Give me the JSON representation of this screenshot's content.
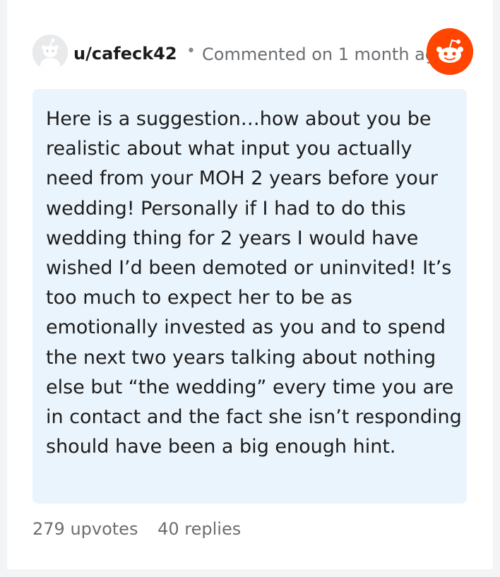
{
  "comment": {
    "username": "u/cafeck42",
    "separator": "•",
    "meta": "Commented on 1 month ago",
    "body": "Here is a suggestion…how about you be realistic about what input you actually need from your MOH 2 years before your wedding! Personally if I had to do this wedding thing for 2 years I would have wished I’d been demoted or uninvited! It’s too much to expect her to be as emotionally invested as you and to spend the next two years talking about nothing else but “the wedding” every time you are in contact and the fact she isn’t responding should have been a big enough hint.",
    "upvotes": "279 upvotes",
    "replies": "40 replies"
  },
  "icons": {
    "avatar": "default-user-avatar-icon",
    "badge": "reddit-snoo-icon"
  },
  "colors": {
    "brand": "#ff4500",
    "bubble": "#eaf4fc",
    "muted_text": "#6b6e72",
    "text": "#1c1c1c"
  }
}
